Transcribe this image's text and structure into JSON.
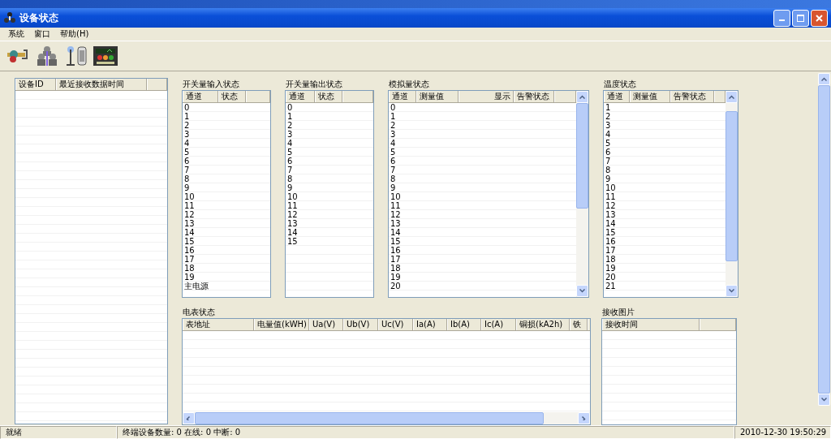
{
  "window": {
    "title": "设备状态"
  },
  "menu": [
    "系统",
    "窗口",
    "帮助(H)"
  ],
  "device_list": {
    "columns": [
      "设备ID",
      "最近接收数据时间"
    ]
  },
  "digital_input": {
    "title": "开关量输入状态",
    "columns": [
      "通道",
      "状态"
    ],
    "rows": [
      "0",
      "1",
      "2",
      "3",
      "4",
      "5",
      "6",
      "7",
      "8",
      "9",
      "10",
      "11",
      "12",
      "13",
      "14",
      "15",
      "16",
      "17",
      "18",
      "19",
      "主电源"
    ]
  },
  "digital_output": {
    "title": "开关量输出状态",
    "columns": [
      "通道",
      "状态"
    ],
    "rows": [
      "0",
      "1",
      "2",
      "3",
      "4",
      "5",
      "6",
      "7",
      "8",
      "9",
      "10",
      "11",
      "12",
      "13",
      "14",
      "15"
    ]
  },
  "analog": {
    "title": "模拟量状态",
    "columns": [
      "通道",
      "测量值",
      "显示",
      "告警状态"
    ],
    "rows": [
      "0",
      "1",
      "2",
      "3",
      "4",
      "5",
      "6",
      "7",
      "8",
      "9",
      "10",
      "11",
      "12",
      "13",
      "14",
      "15",
      "16",
      "17",
      "18",
      "19",
      "20"
    ]
  },
  "temperature": {
    "title": "温度状态",
    "columns": [
      "通道",
      "测量值",
      "告警状态"
    ],
    "rows": [
      "1",
      "2",
      "3",
      "4",
      "5",
      "6",
      "7",
      "8",
      "9",
      "10",
      "11",
      "12",
      "13",
      "14",
      "15",
      "16",
      "17",
      "18",
      "19",
      "20",
      "21"
    ]
  },
  "meter": {
    "title": "电表状态",
    "columns": [
      "表地址",
      "电量值(kWH)",
      "Ua(V)",
      "Ub(V)",
      "Uc(V)",
      "Ia(A)",
      "Ib(A)",
      "Ic(A)",
      "铜损(kA2h)",
      "铁"
    ]
  },
  "pictures": {
    "title": "接收图片",
    "columns": [
      "接收时间"
    ]
  },
  "status_bar": {
    "state": "就绪",
    "counts": "终端设备数量: 0  在线: 0  中断: 0",
    "time": "2010-12-30 19:50:29"
  }
}
